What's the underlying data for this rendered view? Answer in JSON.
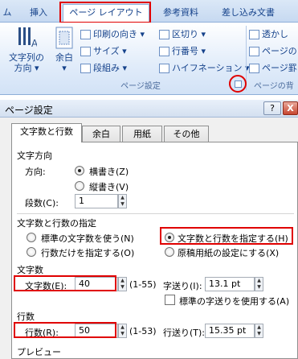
{
  "ribbon": {
    "tabs": [
      {
        "label": "ム"
      },
      {
        "label": "挿入"
      },
      {
        "label": "ページ レイアウト"
      },
      {
        "label": "参考資料"
      },
      {
        "label": "差し込み文書"
      }
    ],
    "big_buttons": [
      {
        "line1": "文字列の",
        "line2": "方向 ▾"
      },
      {
        "line1": "余白",
        "line2": "▾"
      }
    ],
    "small_buttons": [
      {
        "label": "印刷の向き ▾"
      },
      {
        "label": "サイズ ▾"
      },
      {
        "label": "段組み ▾"
      },
      {
        "label": "区切り ▾"
      },
      {
        "label": "行番号 ▾"
      },
      {
        "label": "ハイフネーション ▾"
      },
      {
        "label": "透かし"
      },
      {
        "label": "ページの"
      },
      {
        "label": "ページ罫"
      }
    ],
    "group_page_setup": "ページ設定",
    "group_page_bg": "ページの背"
  },
  "dialog": {
    "title": "ページ設定",
    "help_label": "?",
    "close_label": "X",
    "tabs": [
      "文字数と行数",
      "余白",
      "用紙",
      "その他"
    ],
    "direction": {
      "heading": "文字方向",
      "label": "方向:",
      "horizontal": "横書き(Z)",
      "vertical": "縦書き(V)",
      "columns_label": "段数(C):",
      "columns_value": "1"
    },
    "grid": {
      "heading": "文字数と行数の指定",
      "opt_standard": "標準の文字数を使う(N)",
      "opt_lines_only": "行数だけを指定する(O)",
      "opt_chars_lines": "文字数と行数を指定する(H)",
      "opt_manuscript": "原稿用紙の設定にする(X)"
    },
    "chars": {
      "heading": "文字数",
      "label": "文字数(E):",
      "value": "40",
      "range": "(1-55)",
      "pitch_label": "字送り(I):",
      "pitch_value": "13.1 pt",
      "standard_pitch_label": "標準の字送りを使用する(A)"
    },
    "lines": {
      "heading": "行数",
      "label": "行数(R):",
      "value": "50",
      "range": "(1-53)",
      "pitch_label": "行送り(T):",
      "pitch_value": "15.35 pt"
    },
    "preview_heading": "プレビュー"
  },
  "colors": {
    "highlight": "#e00000",
    "ribbon_text": "#15428b"
  }
}
